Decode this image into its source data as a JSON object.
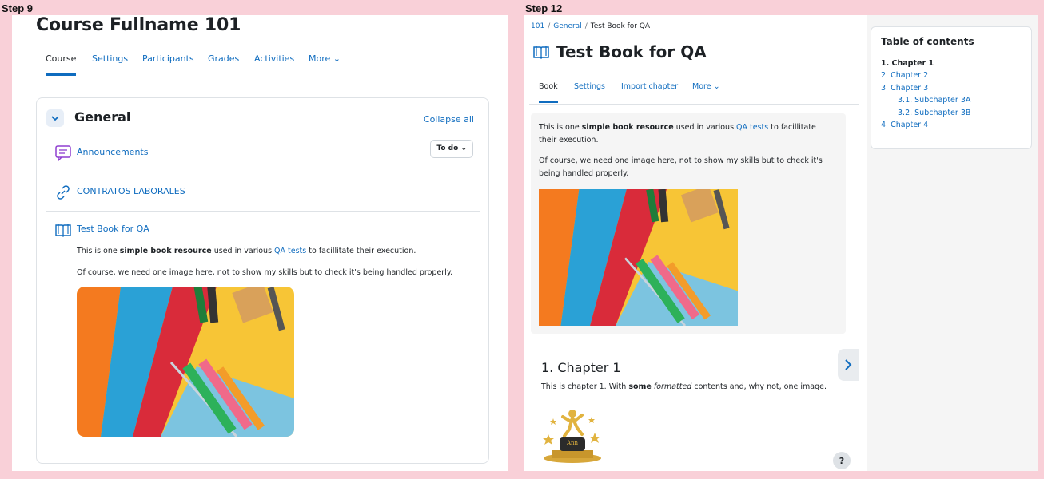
{
  "steps": {
    "left": "Step 9",
    "right": "Step 12"
  },
  "course": {
    "title": "Course Fullname 101",
    "tabs": [
      "Course",
      "Settings",
      "Participants",
      "Grades",
      "Activities",
      "More"
    ],
    "section": {
      "title": "General",
      "collapse_all": "Collapse all",
      "activities": [
        {
          "name": "Announcements",
          "icon": "forum-icon",
          "todo": "To do"
        },
        {
          "name": "CONTRATOS LABORALES",
          "icon": "url-link-icon"
        },
        {
          "name": "Test Book for QA",
          "icon": "book-icon"
        }
      ],
      "book_desc": {
        "line1_pre": "This is one ",
        "line1_bold": "simple book resource",
        "line1_mid": " used in various ",
        "line1_link": "QA tests",
        "line1_post": " to facillitate their execution.",
        "line2": "Of course, we need one image here, not to show my skills but to check it's being handled properly."
      }
    }
  },
  "book": {
    "breadcrumb": [
      "101",
      "General",
      "Test Book for QA"
    ],
    "title": "Test Book for QA",
    "tabs": [
      "Book",
      "Settings",
      "Import chapter",
      "More"
    ],
    "intro": {
      "p1_pre": "This is one ",
      "p1_bold": "simple book resource",
      "p1_mid": " used in various ",
      "p1_link": "QA tests",
      "p1_post": " to facillitate their execution.",
      "p2": "Of course, we need one image here, not to show my skills but to check it's being handled properly."
    },
    "chapter": {
      "title": "1. Chapter 1",
      "text_pre": "This is chapter 1. With ",
      "text_bold": "some",
      "text_italic": "formatted",
      "text_underline": "contents",
      "text_post": " and, why not, one image.",
      "trophy_label": "Ann"
    },
    "help": "?",
    "toc": {
      "title": "Table of contents",
      "items": [
        "1. Chapter 1",
        "2. Chapter 2",
        "3. Chapter 3",
        "3.1. Subchapter 3A",
        "3.2. Subchapter 3B",
        "4. Chapter 4"
      ]
    }
  },
  "colors": {
    "link": "#0f6cbf",
    "background": "#f9d0d8",
    "text": "#1d2125"
  }
}
